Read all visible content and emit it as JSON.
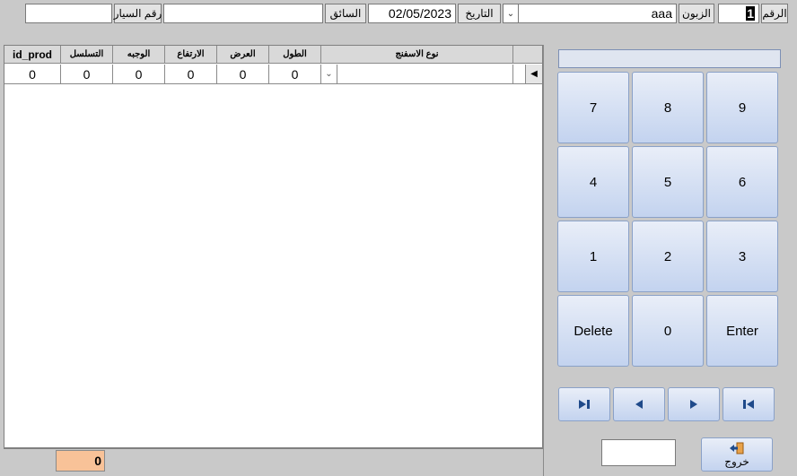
{
  "header": {
    "number_label": "الرقم",
    "number_value": "1",
    "customer_label": "الزبون",
    "customer_value": "aaa",
    "date_label": "التاريخ",
    "date_value": "02/05/2023",
    "driver_label": "السائق",
    "driver_value": "",
    "car_number_label": "رقم السيار",
    "car_number_value": ""
  },
  "grid": {
    "columns": [
      "id_prod",
      "التسلسل",
      "الوجبه",
      "الارتفاع",
      "العرض",
      "الطول",
      "نوع الاسفنج"
    ],
    "row": [
      "0",
      "0",
      "0",
      "0",
      "0",
      "0",
      ""
    ],
    "total": "0"
  },
  "keypad": {
    "display": "",
    "keys": [
      "7",
      "8",
      "9",
      "4",
      "5",
      "6",
      "1",
      "2",
      "3",
      "Delete",
      "0",
      "Enter"
    ]
  },
  "navigation": {
    "icons": [
      "last-record-icon",
      "previous-record-icon",
      "next-record-icon",
      "first-record-icon"
    ]
  },
  "footer": {
    "exit_label": "خروج",
    "small_field": ""
  }
}
